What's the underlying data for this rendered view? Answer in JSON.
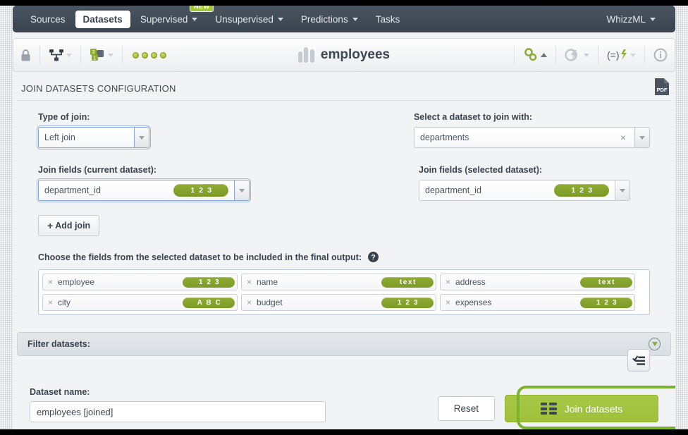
{
  "nav": {
    "items": [
      {
        "label": "Sources",
        "caret": false,
        "active": false,
        "badge": null
      },
      {
        "label": "Datasets",
        "caret": false,
        "active": true,
        "badge": null
      },
      {
        "label": "Supervised",
        "caret": true,
        "active": false,
        "badge": "NEW"
      },
      {
        "label": "Unsupervised",
        "caret": true,
        "active": false,
        "badge": null
      },
      {
        "label": "Predictions",
        "caret": true,
        "active": false,
        "badge": null
      },
      {
        "label": "Tasks",
        "caret": false,
        "active": false,
        "badge": null
      }
    ],
    "right": {
      "label": "WhizzML",
      "caret": true
    }
  },
  "toolbar": {
    "lock_icon": "lock-icon",
    "share_icon": "network-share-icon",
    "sample_icon": "dataset-sample-icon",
    "status_dots": 4,
    "title": "employees",
    "right_icons": [
      {
        "name": "configure-gears-icon",
        "state": "enabled"
      },
      {
        "name": "cloud-bolt-icon",
        "state": "disabled"
      },
      {
        "name": "batch-formula-icon",
        "state": "enabled"
      },
      {
        "name": "info-icon",
        "state": "enabled"
      }
    ]
  },
  "side": {
    "pdf_icon": "pdf-download-icon",
    "help_icon": "help-question-icon"
  },
  "section": {
    "title": "JOIN DATASETS CONFIGURATION"
  },
  "form": {
    "join_type": {
      "label": "Type of join:",
      "value": "Left join"
    },
    "dataset_select": {
      "label": "Select a dataset to join with:",
      "value": "departments",
      "clear": "×"
    },
    "join_fields_current": {
      "label": "Join fields (current dataset):",
      "value": "department_id",
      "type_badge": "1 2 3"
    },
    "join_fields_selected": {
      "label": "Join fields (selected dataset):",
      "value": "department_id",
      "type_badge": "1 2 3"
    },
    "add_join_button": {
      "plus": "+",
      "label": "Add join"
    },
    "choose_fields": {
      "label": "Choose the fields from the selected dataset to be included in the final output:",
      "help": "?",
      "select_all_icon": "checklist-icon"
    },
    "field_chips": [
      {
        "name": "employee",
        "type_badge": "1 2 3",
        "remove": "×"
      },
      {
        "name": "name",
        "type_badge": "text",
        "remove": "×"
      },
      {
        "name": "address",
        "type_badge": "text",
        "remove": "×"
      },
      {
        "name": "city",
        "type_badge": "A B C",
        "remove": "×"
      },
      {
        "name": "budget",
        "type_badge": "1 2 3",
        "remove": "×"
      },
      {
        "name": "expenses",
        "type_badge": "1 2 3",
        "remove": "×"
      }
    ],
    "filter_section": {
      "label": "Filter datasets:",
      "expand_icon": "chevron-down-icon"
    },
    "dataset_name": {
      "label": "Dataset name:",
      "value": "employees [joined]"
    },
    "reset_button": "Reset",
    "join_button": "Join datasets"
  },
  "colors": {
    "accent_green": "#9ec03b",
    "badge_green": "#8fac34",
    "nav_dark": "#39434e",
    "highlight": "#7ab42e"
  }
}
